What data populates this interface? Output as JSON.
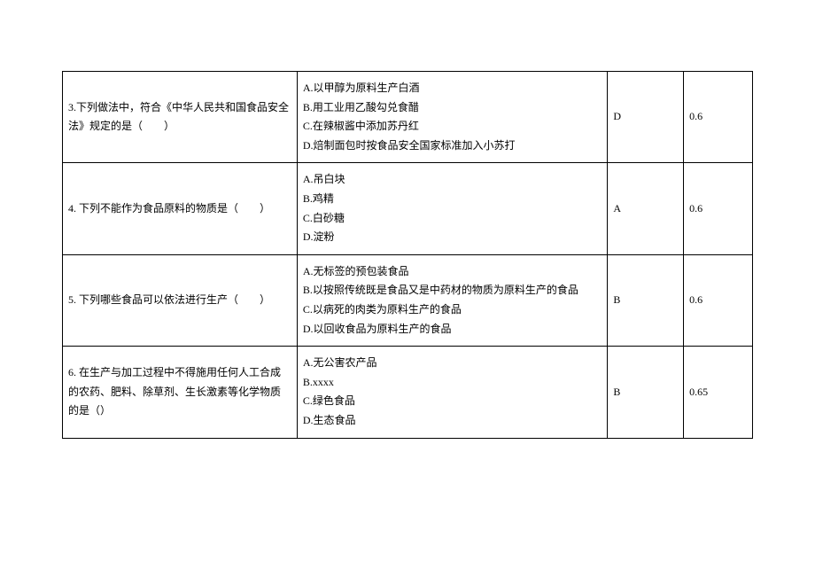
{
  "rows": [
    {
      "question": "3.下列做法中，符合《中华人民共和国食品安全法》规定的是（　　）",
      "optA": "A.以甲醇为原料生产白酒",
      "optB": "B.用工业用乙酸勾兑食醋",
      "optC": "C.在辣椒酱中添加苏丹红",
      "optD": "D.焙制面包时按食品安全国家标准加入小苏打",
      "answer": "D",
      "score": "0.6"
    },
    {
      "question": "4. 下列不能作为食品原料的物质是（　　）",
      "optA": "A.吊白块",
      "optB": "B.鸡精",
      "optC": "C.白砂糖",
      "optD": "D.淀粉",
      "answer": "A",
      "score": "0.6"
    },
    {
      "question": "5. 下列哪些食品可以依法进行生产（　　）",
      "optA": "A.无标签的预包装食品",
      "optB": "B.以按照传统既是食品又是中药材的物质为原料生产的食品",
      "optC": "C.以病死的肉类为原料生产的食品",
      "optD": "D.以回收食品为原料生产的食品",
      "answer": "B",
      "score": "0.6"
    },
    {
      "question": "6. 在生产与加工过程中不得施用任何人工合成的农药、肥料、除草剂、生长激素等化学物质的是（）",
      "optA": "A.无公害农产品",
      "optB": "B.xxxx",
      "optC": "C.绿色食品",
      "optD": "D.生态食品",
      "answer": "B",
      "score": "0.65"
    }
  ]
}
